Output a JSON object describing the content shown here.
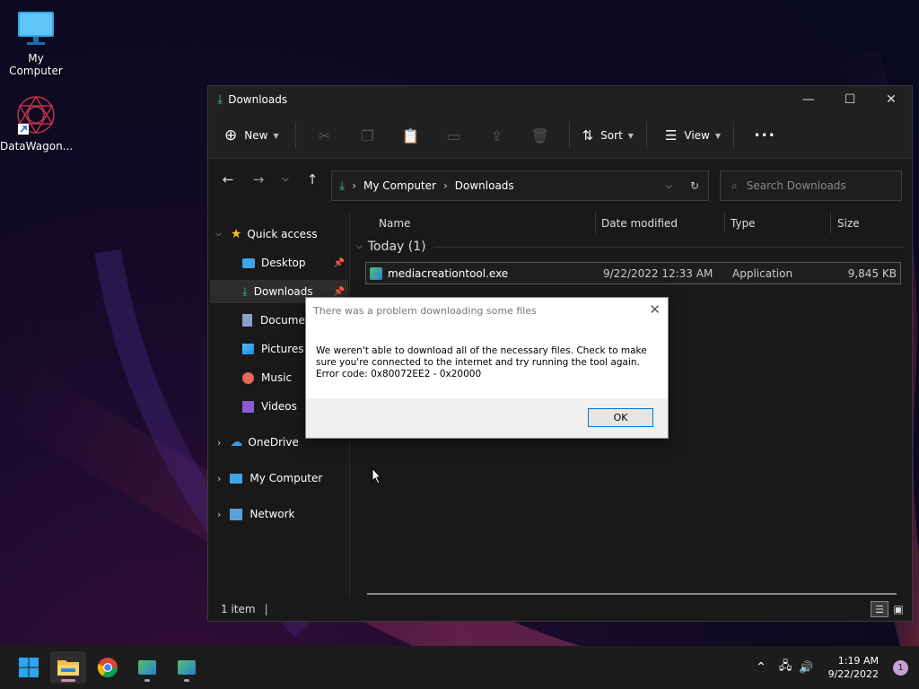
{
  "desktop": {
    "icons": [
      {
        "label": "My Computer",
        "icon": "monitor-icon"
      },
      {
        "label": "DataWagon...",
        "icon": "datawagon-logo-icon"
      }
    ]
  },
  "window": {
    "title": "Downloads",
    "toolbar": {
      "new_label": "New",
      "sort_label": "Sort",
      "view_label": "View",
      "more_label": "•••"
    },
    "address": {
      "crumbs": [
        "My Computer",
        "Downloads"
      ]
    },
    "search": {
      "placeholder": "Search Downloads"
    },
    "sidebar": {
      "quick_access": "Quick access",
      "items": [
        "Desktop",
        "Downloads",
        "Documents",
        "Pictures",
        "Music",
        "Videos"
      ],
      "onedrive": "OneDrive",
      "my_computer": "My Computer",
      "network": "Network"
    },
    "columns": [
      "Name",
      "Date modified",
      "Type",
      "Size"
    ],
    "group": "Today (1)",
    "files": [
      {
        "name": "mediacreationtool.exe",
        "date": "9/22/2022 12:33 AM",
        "type": "Application",
        "size": "9,845 KB"
      }
    ],
    "status": "1 item"
  },
  "dialog": {
    "title": "There was a problem downloading some files",
    "message_line1": "We weren't able to download all of the necessary files. Check to make",
    "message_line2": "sure you're connected to the internet and try running the tool again.",
    "message_line3": "Error code: 0x80072EE2 - 0x20000",
    "ok_label": "OK"
  },
  "taskbar": {
    "time": "1:19 AM",
    "date": "9/22/2022",
    "notifications": "1"
  }
}
